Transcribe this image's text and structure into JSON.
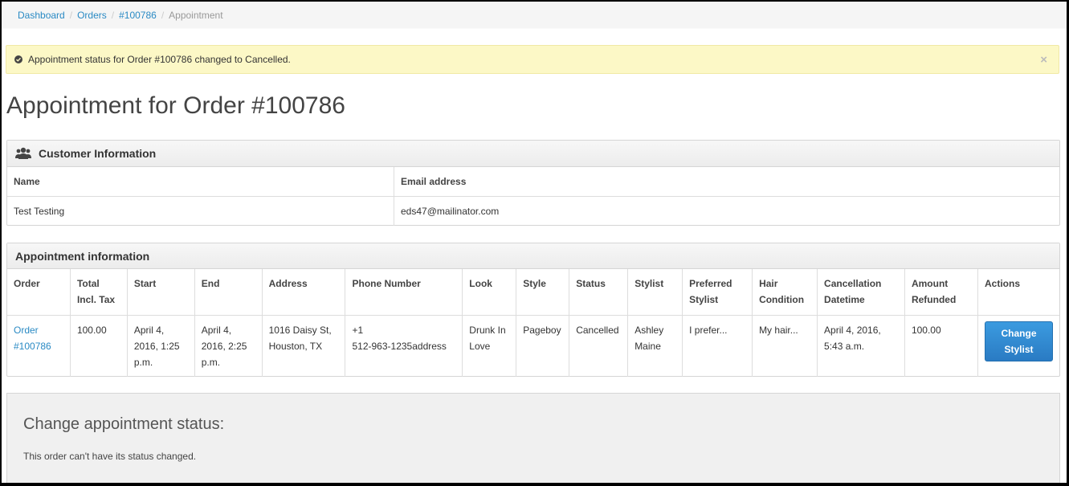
{
  "breadcrumb": {
    "items": [
      "Dashboard",
      "Orders",
      "#100786"
    ],
    "active": "Appointment",
    "separator": "/"
  },
  "alert": {
    "message": "Appointment status for Order #100786 changed to Cancelled.",
    "close": "×",
    "background": "#fcf8c6"
  },
  "page_title": "Appointment for Order #100786",
  "customer_panel": {
    "title": "Customer Information",
    "icon": "users-icon",
    "headers": [
      "Name",
      "Email address"
    ],
    "row": [
      "Test Testing",
      "eds47@mailinator.com"
    ]
  },
  "appointment_panel": {
    "title": "Appointment information",
    "headers": [
      [
        "Order"
      ],
      [
        "Total",
        "Incl. Tax"
      ],
      [
        "Start"
      ],
      [
        "End"
      ],
      [
        "Address"
      ],
      [
        "Phone Number"
      ],
      [
        "Look"
      ],
      [
        "Style"
      ],
      [
        "Status"
      ],
      [
        "Stylist"
      ],
      [
        "Preferred",
        "Stylist"
      ],
      [
        "Hair",
        "Condition"
      ],
      [
        "Cancellation",
        "Datetime"
      ],
      [
        "Amount",
        "Refunded"
      ],
      [
        "Actions"
      ]
    ],
    "row": {
      "order": [
        "Order",
        "#100786"
      ],
      "total": "100.00",
      "start": [
        "April 4,",
        "2016, 1:25",
        "p.m."
      ],
      "end": [
        "April 4,",
        "2016, 2:25",
        "p.m."
      ],
      "address": [
        "1016 Daisy St,",
        "Houston, TX"
      ],
      "phone": [
        "+1",
        "512-963-1235address"
      ],
      "look": [
        "Drunk In",
        "Love"
      ],
      "style": "Pageboy",
      "status": "Cancelled",
      "stylist": [
        "Ashley",
        "Maine"
      ],
      "preferred": "I prefer...",
      "hair": "My hair...",
      "cancellation": [
        "April 4, 2016,",
        "5:43 a.m."
      ],
      "refunded": "100.00",
      "action": [
        "Change",
        "Stylist"
      ]
    },
    "accent_color": "#2a8ac4",
    "button_color": "#2a7bc3"
  },
  "status_section": {
    "title": "Change appointment status:",
    "message": "This order can't have its status changed."
  }
}
